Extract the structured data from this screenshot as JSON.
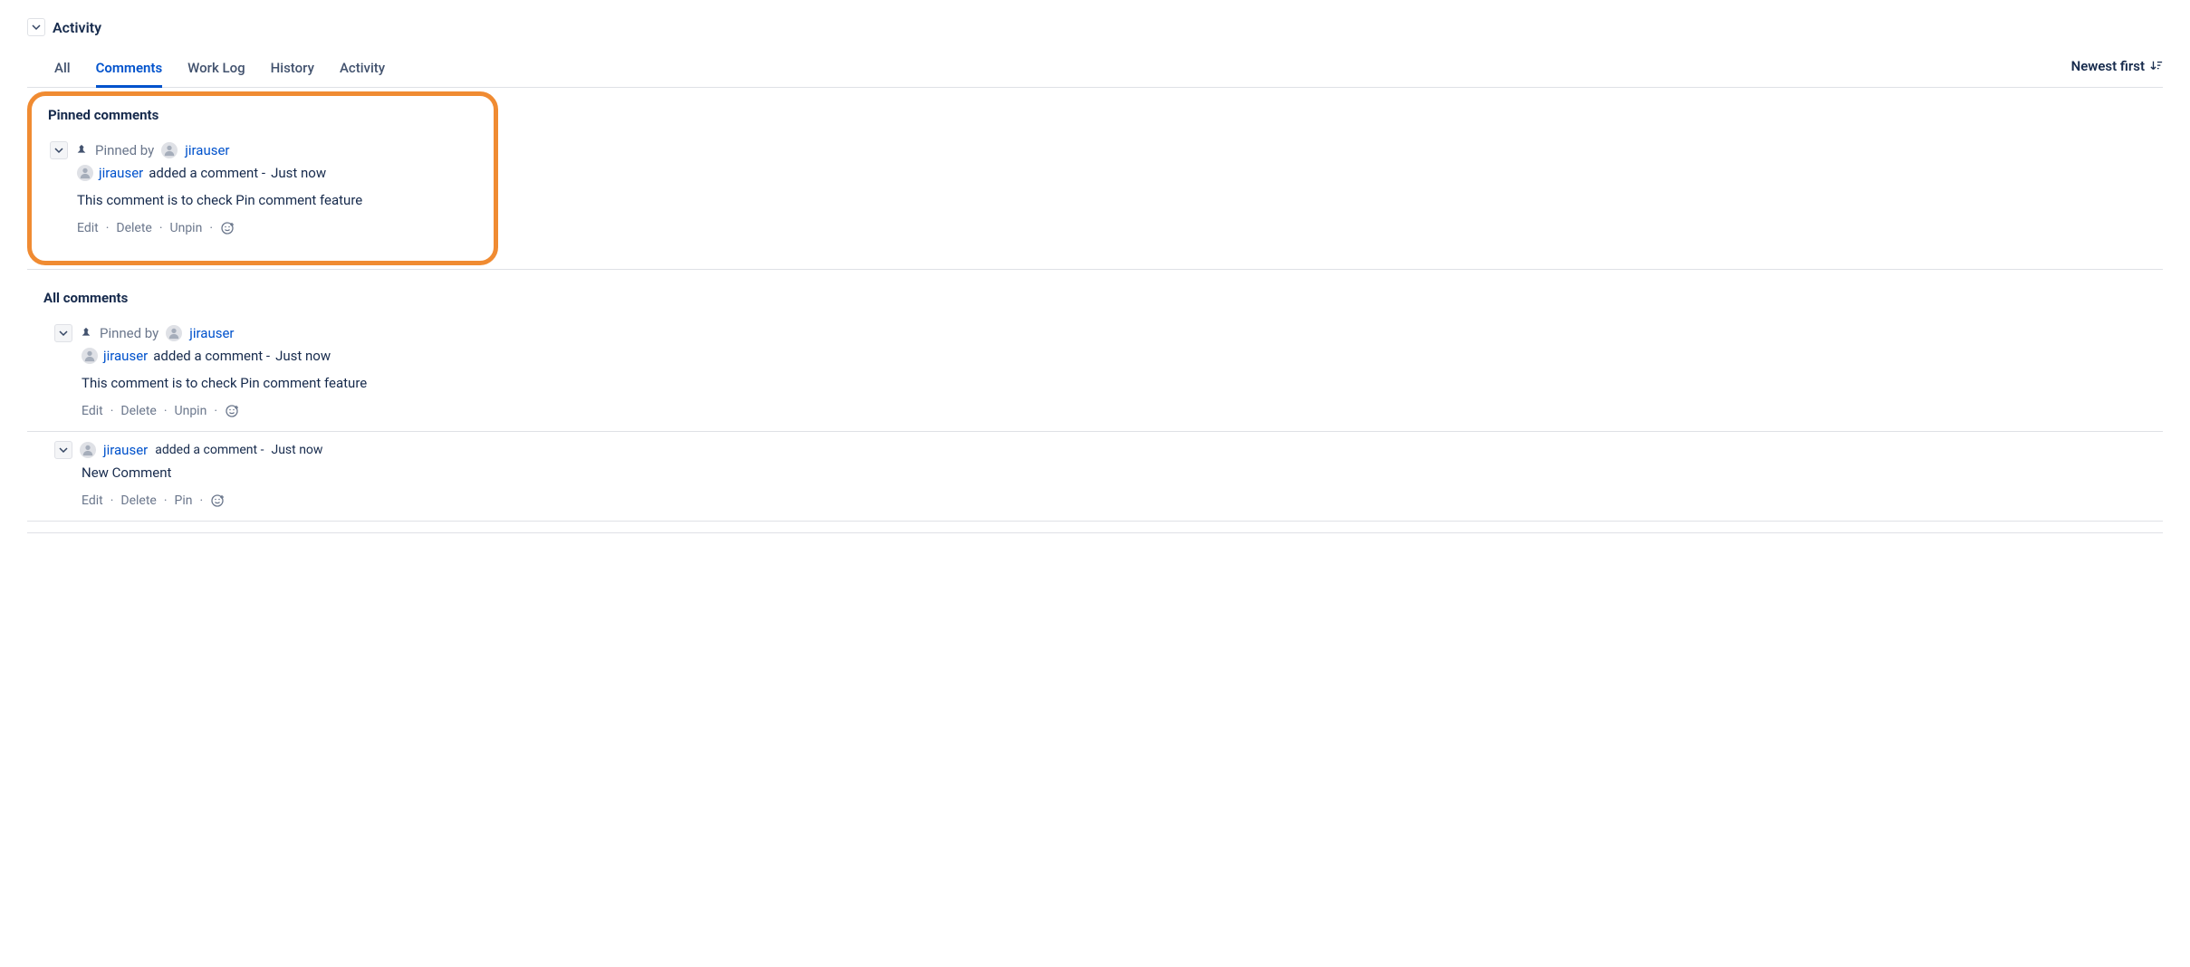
{
  "header": {
    "title": "Activity"
  },
  "tabs": {
    "all": "All",
    "comments": "Comments",
    "worklog": "Work Log",
    "history": "History",
    "activity": "Activity"
  },
  "sort": {
    "label": "Newest first"
  },
  "pinned": {
    "heading": "Pinned comments",
    "pinnedByLabel": "Pinned by",
    "pinnedByUser": "jirauser",
    "author": "jirauser",
    "authorAction": "added a comment -",
    "time": "Just now",
    "body": "This comment is to check Pin comment feature",
    "actions": {
      "edit": "Edit",
      "delete": "Delete",
      "unpin": "Unpin"
    }
  },
  "all": {
    "heading": "All comments",
    "items": [
      {
        "pinned": true,
        "pinnedByLabel": "Pinned by",
        "pinnedByUser": "jirauser",
        "author": "jirauser",
        "authorAction": "added a comment -",
        "time": "Just now",
        "body": "This comment is to check Pin comment feature",
        "actions": {
          "edit": "Edit",
          "delete": "Delete",
          "toggle": "Unpin"
        }
      },
      {
        "pinned": false,
        "author": "jirauser",
        "authorAction": "added a comment -",
        "time": "Just now",
        "body": "New Comment",
        "actions": {
          "edit": "Edit",
          "delete": "Delete",
          "toggle": "Pin"
        }
      }
    ]
  }
}
